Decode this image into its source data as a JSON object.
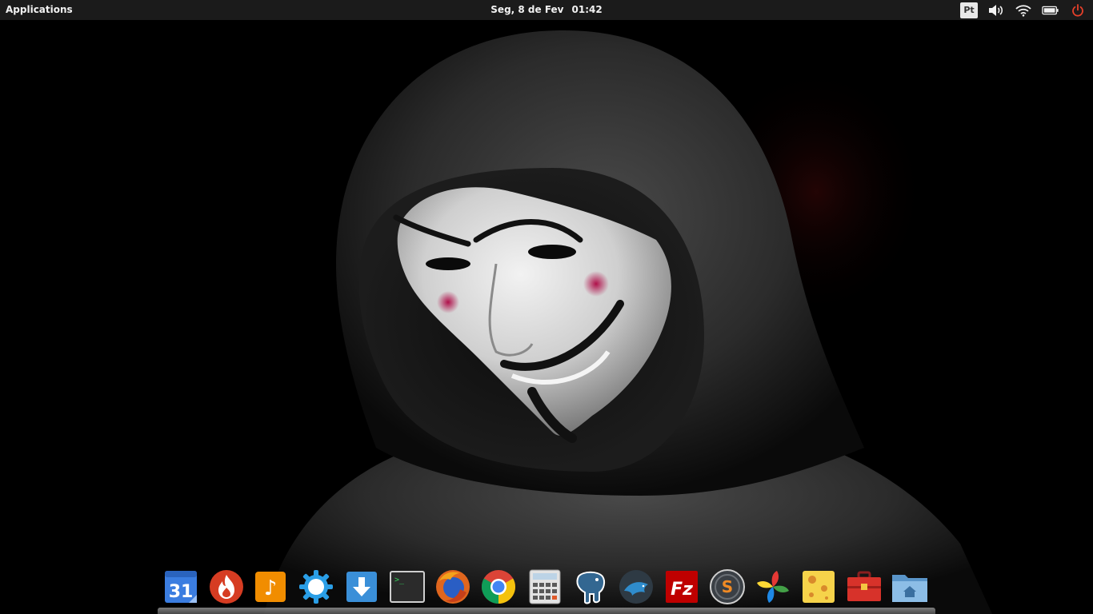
{
  "top_panel": {
    "applications_label": "Applications",
    "clock": {
      "date": "Seg,  8 de Fev",
      "time": "01:42"
    },
    "indicators": {
      "keyboard_layout": "Pt",
      "volume_icon": "volume-icon",
      "wifi_icon": "wifi-icon",
      "battery_icon": "battery-icon",
      "power_icon": "power-icon"
    }
  },
  "wallpaper": {
    "description_icon": "wallpaper-image"
  },
  "dock": {
    "items": [
      {
        "name": "calendar",
        "icon": "calendar-icon",
        "label": "31"
      },
      {
        "name": "burner",
        "icon": "flame-icon"
      },
      {
        "name": "music",
        "icon": "music-icon",
        "label": "♪"
      },
      {
        "name": "settings",
        "icon": "gear-icon"
      },
      {
        "name": "downloads",
        "icon": "download-icon"
      },
      {
        "name": "terminal",
        "icon": "terminal-icon",
        "label": ">_"
      },
      {
        "name": "firefox",
        "icon": "firefox-icon"
      },
      {
        "name": "chrome",
        "icon": "chrome-icon"
      },
      {
        "name": "calculator",
        "icon": "calculator-icon"
      },
      {
        "name": "postgresql",
        "icon": "elephant-icon"
      },
      {
        "name": "mysql-workbench",
        "icon": "dolphin-icon"
      },
      {
        "name": "filezilla",
        "icon": "filezilla-icon",
        "label": "Fz"
      },
      {
        "name": "sublime",
        "icon": "sublime-icon",
        "label": "S"
      },
      {
        "name": "photos",
        "icon": "pinwheel-icon"
      },
      {
        "name": "notes",
        "icon": "cheese-icon"
      },
      {
        "name": "toolbox",
        "icon": "toolbox-icon"
      },
      {
        "name": "files",
        "icon": "home-folder-icon"
      }
    ]
  },
  "colors": {
    "panel_bg": "#1b1b1b",
    "panel_text": "#f2f2f2",
    "power_red": "#e8402a"
  }
}
